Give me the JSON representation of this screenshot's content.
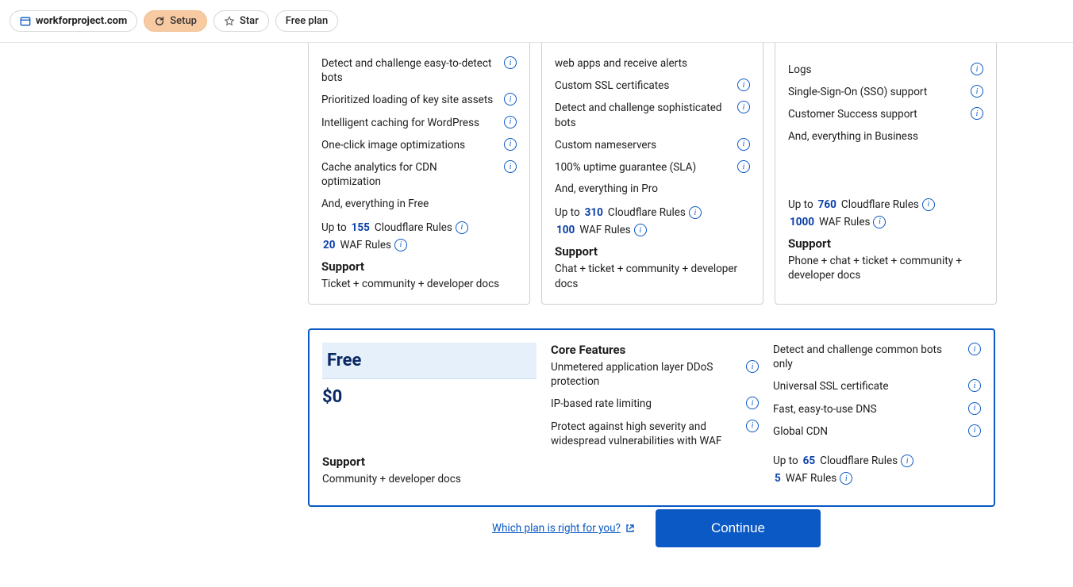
{
  "topbar": {
    "site": "workforproject.com",
    "setup_label": "Setup",
    "star_label": "Star",
    "plan_label": "Free plan"
  },
  "plans_row": [
    {
      "features": [
        "Detect and challenge easy-to-detect bots",
        "Prioritized loading of key site assets",
        "Intelligent caching for WordPress",
        "One-click image optimizations",
        "Cache analytics for CDN optimization"
      ],
      "note": "And, everything in Free",
      "rules_prefix": "Up to",
      "rules_count": "155",
      "rules_label": "Cloudflare Rules",
      "waf_count": "20",
      "waf_label": "WAF Rules",
      "support_head": "Support",
      "support_text": "Ticket + community + developer docs"
    },
    {
      "features": [
        "web apps and receive alerts",
        "Custom SSL certificates",
        "Detect and challenge sophisticated bots",
        "Custom nameservers",
        "100% uptime guarantee (SLA)"
      ],
      "note": "And, everything in Pro",
      "rules_prefix": "Up to",
      "rules_count": "310",
      "rules_label": "Cloudflare Rules",
      "waf_count": "100",
      "waf_label": "WAF Rules",
      "support_head": "Support",
      "support_text": "Chat + ticket + community + developer docs"
    },
    {
      "features": [
        "Logs",
        "Single-Sign-On (SSO) support",
        "Customer Success support"
      ],
      "note": "And, everything in Business",
      "rules_prefix": "Up to",
      "rules_count": "760",
      "rules_label": "Cloudflare Rules",
      "waf_count": "1000",
      "waf_label": "WAF Rules",
      "support_head": "Support",
      "support_text": "Phone + chat + ticket + community + developer docs"
    }
  ],
  "free": {
    "title": "Free",
    "price": "$0",
    "support_head": "Support",
    "support_text": "Community + developer docs",
    "core_head": "Core Features",
    "core_features": [
      "Unmetered application layer DDoS protection",
      "IP-based rate limiting",
      "Protect against high severity and widespread vulnerabilities with WAF"
    ],
    "right_features": [
      "Detect and challenge common bots only",
      "Universal SSL certificate",
      "Fast, easy-to-use DNS",
      "Global CDN"
    ],
    "rules_prefix": "Up to",
    "rules_count": "65",
    "rules_label": "Cloudflare Rules",
    "waf_count": "5",
    "waf_label": "WAF Rules"
  },
  "actions": {
    "which_plan": "Which plan is right for you?",
    "continue": "Continue"
  }
}
